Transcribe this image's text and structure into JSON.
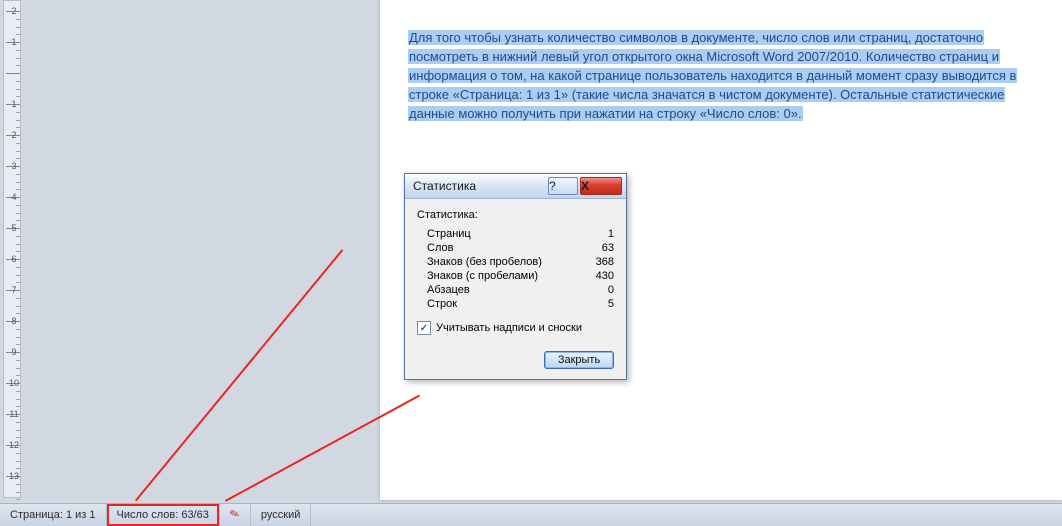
{
  "ruler": {
    "labels": [
      "2",
      "1",
      "",
      "1",
      "2",
      "3",
      "4",
      "5",
      "6",
      "7",
      "8",
      "9",
      "10",
      "11",
      "12",
      "13"
    ]
  },
  "paragraph": {
    "t1": "Для того чтобы узнать количество символов в документе, число слов или страниц, достаточно",
    "t2": "посмотреть в нижний левый угол открытого окна Microsoft Word 2007/2010. Количество страниц и",
    "t3": "информация о том, на какой странице пользователь находится в данный момент сразу выводится в",
    "t4": "строке «Страница: 1 из 1» (такие числа значатся в чистом документе). Остальные статистические",
    "t5": "данные можно получить при нажатии на строку «Число слов: 0»."
  },
  "dialog": {
    "title": "Статистика",
    "heading": "Статистика:",
    "rows": [
      {
        "label": "Страниц",
        "value": "1"
      },
      {
        "label": "Слов",
        "value": "63"
      },
      {
        "label": "Знаков (без пробелов)",
        "value": "368"
      },
      {
        "label": "Знаков (с пробелами)",
        "value": "430"
      },
      {
        "label": "Абзацев",
        "value": "0"
      },
      {
        "label": "Строк",
        "value": "5"
      }
    ],
    "checkbox_label": "Учитывать надписи и сноски",
    "close": "Закрыть"
  },
  "statusbar": {
    "page": "Страница: 1 из 1",
    "words": "Число слов: 63/63",
    "lang": "русский"
  },
  "glyph": {
    "x": "X",
    "q": "?",
    "check": "✓",
    "pen": "✎"
  }
}
